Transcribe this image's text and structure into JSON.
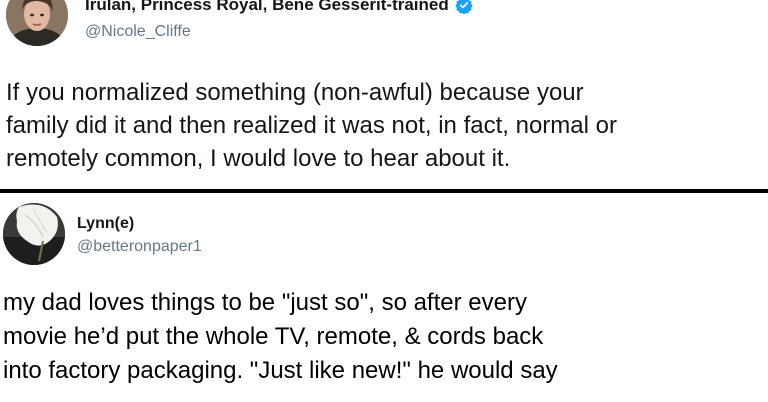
{
  "tweets": [
    {
      "display_name": "Irulan, Princess Royal, Bene Gesserit-trained",
      "handle": "@Nicole_Cliffe",
      "verified": true,
      "text_lines": [
        "If you normalized something (non-awful) because your",
        "family did it and then realized it was not, in fact, normal or",
        "remotely common, I would love to hear about it."
      ]
    },
    {
      "display_name": "Lynn(e)",
      "handle": "@betteronpaper1",
      "verified": false,
      "text_lines": [
        "my dad loves things to be \"just so\", so after every",
        "movie he’d put the whole TV, remote, & cords back",
        "into factory packaging. \"Just like new!\" he would say"
      ]
    }
  ],
  "colors": {
    "text": "#14171a",
    "handle": "#657786",
    "verified": "#1da1f2",
    "divider": "#000000"
  },
  "icons": {
    "verified": "verified-badge-icon"
  }
}
